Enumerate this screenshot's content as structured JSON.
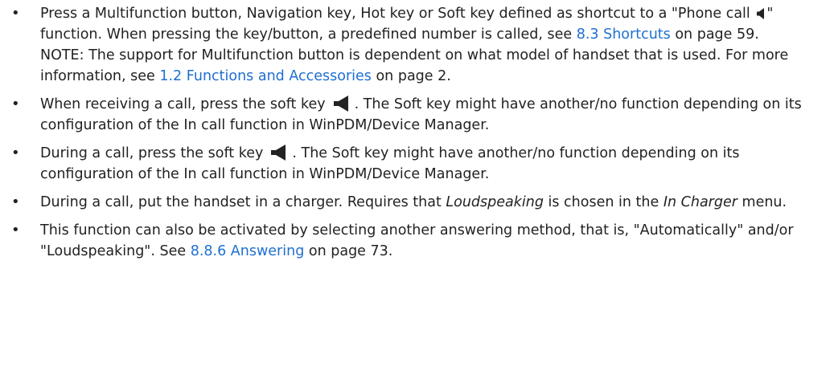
{
  "bullets": [
    {
      "text_a": "Press a Multifunction button, Navigation key, Hot key or Soft key defined as shortcut to a \"Phone call ",
      "icon": "speaker-icon",
      "text_b": "\" function. When pressing the key/button, a predefined number is called, see ",
      "link_1": "8.3 Shortcuts",
      "text_c": " on page 59.",
      "note_a": "NOTE: The support for Multifunction button is dependent on what model of handset that is used. For more information, see ",
      "note_link": "1.2 Functions and Accessories",
      "note_b": " on page 2."
    },
    {
      "text_a": "When receiving a call, press the soft key",
      "icon": "loudspeaker-soft-key-icon",
      "text_b": ". The Soft key might have another/no function depending on its configuration of the In call function in WinPDM/Device Manager."
    },
    {
      "text_a": "During a call, press the soft key",
      "icon": "loudspeaker-soft-key-icon",
      "text_b": ". The Soft key might have another/no function depending on its configuration of the In call function in WinPDM/Device Manager."
    },
    {
      "text_a": "During a call, put the handset in a charger. Requires that ",
      "em_1": "Loudspeaking",
      "text_b": " is chosen in the ",
      "em_2": "In Charger",
      "text_c": " menu."
    },
    {
      "text_a": "This function can also be activated by selecting another answering method, that is, \"Automatically\" and/or \"Loudspeaking\". See ",
      "link_1": "8.8.6 Answering",
      "text_b": " on page 73."
    }
  ],
  "bullet_char": "•",
  "colors": {
    "text": "#222222",
    "link": "#1f6fd1"
  }
}
